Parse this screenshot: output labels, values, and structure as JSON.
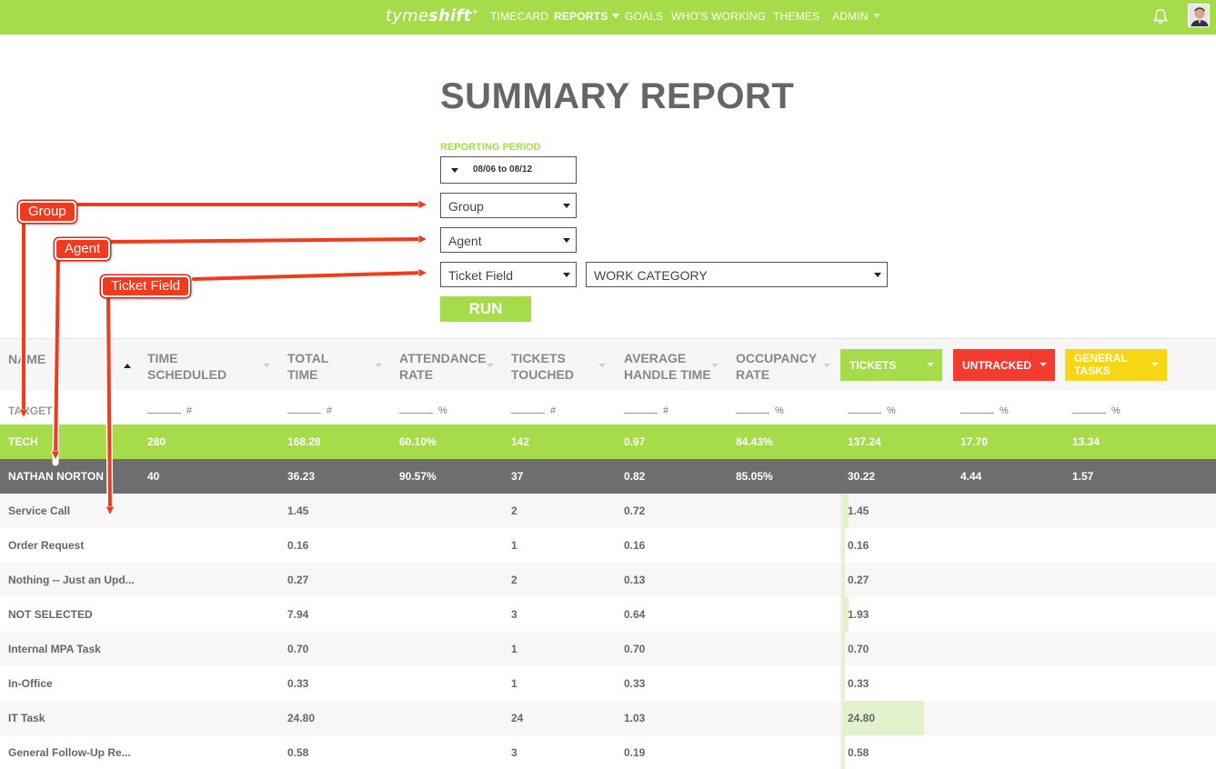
{
  "nav": {
    "logo_main": "tyme",
    "logo_bold": "shift",
    "logo_mark": "+",
    "items": [
      {
        "label": "TIMECARD"
      },
      {
        "label": "REPORTS"
      },
      {
        "label": "GOALS"
      },
      {
        "label": "WHO'S WORKING"
      },
      {
        "label": "THEMES"
      },
      {
        "label": "ADMIN"
      }
    ],
    "icons": {
      "notifications": "bell-icon",
      "user": "user-avatar"
    },
    "colors": {
      "bar": "#a6dc4a"
    }
  },
  "page": {
    "title": "SUMMARY REPORT",
    "reporting_period_label": "REPORTING PERIOD",
    "reporting_period_value": "08/06 to 08/12",
    "group_select": "Group",
    "agent_select": "Agent",
    "ticket_field_select": "Ticket Field",
    "work_category_select": "WORK CATEGORY",
    "run_label": "RUN"
  },
  "table": {
    "headers": {
      "name": "NAME",
      "time_scheduled": [
        "TIME",
        "SCHEDULED"
      ],
      "total_time": [
        "TOTAL",
        "TIME"
      ],
      "attendance_rate": [
        "ATTENDANCE",
        "RATE"
      ],
      "tickets_touched": [
        "TICKETS",
        "TOUCHED"
      ],
      "average_handle_time": [
        "AVERAGE",
        "HANDLE TIME"
      ],
      "occupancy_rate": [
        "OCCUPANCY",
        "RATE"
      ]
    },
    "categories": [
      {
        "label": "TICKETS",
        "color": "#a6dc4a"
      },
      {
        "label": "UNTRACKED",
        "color": "#f53b2f"
      },
      {
        "label": [
          "GENERAL",
          "TASKS"
        ],
        "color": "#f7d613"
      }
    ],
    "target": {
      "label": "TARGET",
      "units": [
        "#",
        "#",
        "%",
        "#",
        "#",
        "%",
        "%",
        "%",
        "%"
      ]
    },
    "group_row": {
      "name": "TECH",
      "values": [
        "280",
        "168.28",
        "60.10%",
        "142",
        "0.97",
        "84.43%",
        "137.24",
        "17.70",
        "13.34"
      ]
    },
    "agent_row": {
      "name": "NATHAN NORTON",
      "values": [
        "40",
        "36.23",
        "90.57%",
        "37",
        "0.82",
        "85.05%",
        "30.22",
        "4.44",
        "1.57"
      ]
    },
    "detail_rows": [
      {
        "name": "Service Call",
        "total_time": "1.45",
        "tickets_touched": "2",
        "aht": "0.72",
        "tickets": "1.45",
        "share": 0.06
      },
      {
        "name": "Order Request",
        "total_time": "0.16",
        "tickets_touched": "1",
        "aht": "0.16",
        "tickets": "0.16",
        "share": 0.005
      },
      {
        "name": "Nothing -- Just an Upd...",
        "total_time": "0.27",
        "tickets_touched": "2",
        "aht": "0.13",
        "tickets": "0.27",
        "share": 0.01
      },
      {
        "name": "NOT SELECTED",
        "total_time": "7.94",
        "tickets_touched": "3",
        "aht": "0.64",
        "tickets": "1.93",
        "share": 0.06
      },
      {
        "name": "Internal MPA Task",
        "total_time": "0.70",
        "tickets_touched": "1",
        "aht": "0.70",
        "tickets": "0.70",
        "share": 0.025
      },
      {
        "name": "In-Office",
        "total_time": "0.33",
        "tickets_touched": "1",
        "aht": "0.33",
        "tickets": "0.33",
        "share": 0.01
      },
      {
        "name": "IT Task",
        "total_time": "24.80",
        "tickets_touched": "24",
        "aht": "1.03",
        "tickets": "24.80",
        "share": 0.82
      },
      {
        "name": "General Follow-Up Re...",
        "total_time": "0.58",
        "tickets_touched": "3",
        "aht": "0.19",
        "tickets": "0.58",
        "share": 0.02
      }
    ]
  },
  "annotations": {
    "group": "Group",
    "agent": "Agent",
    "ticket_field": "Ticket Field",
    "color": "#f23a1c"
  }
}
